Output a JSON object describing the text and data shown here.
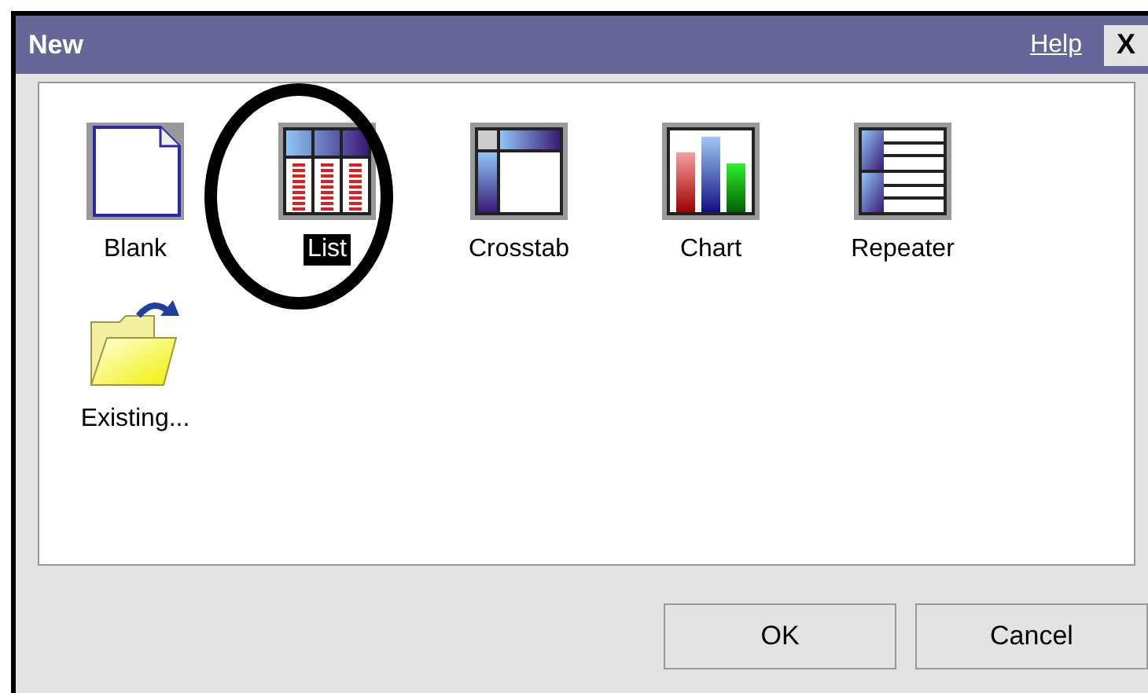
{
  "window": {
    "title": "New",
    "help_link": "Help",
    "close": "X"
  },
  "templates": [
    {
      "label": "Blank",
      "kind": "blank",
      "selected": false
    },
    {
      "label": "List",
      "kind": "list",
      "selected": true
    },
    {
      "label": "Crosstab",
      "kind": "crosstab",
      "selected": false
    },
    {
      "label": "Chart",
      "kind": "chart",
      "selected": false
    },
    {
      "label": "Repeater",
      "kind": "repeater",
      "selected": false
    },
    {
      "label": "Existing...",
      "kind": "folder",
      "selected": false
    }
  ],
  "buttons": [
    "OK",
    "Cancel"
  ]
}
